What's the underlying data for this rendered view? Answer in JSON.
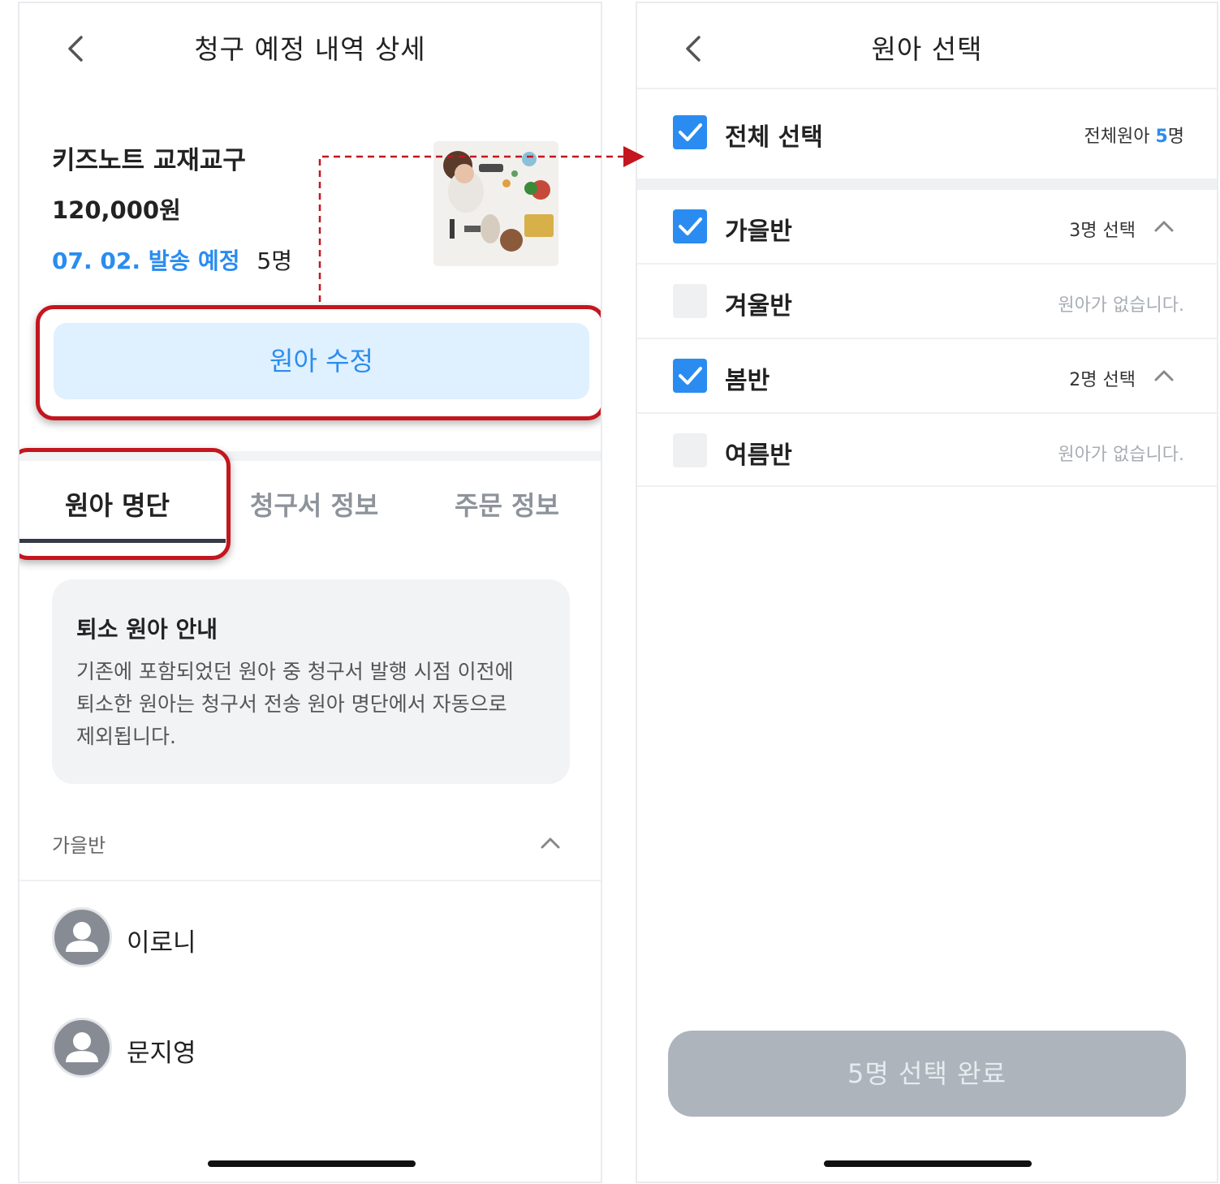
{
  "left": {
    "title": "청구 예정 내역 상세",
    "product": {
      "name": "키즈노트 교재교구",
      "price": "120,000원",
      "ship_date": "07. 02. 발송 예정",
      "count": "5명"
    },
    "edit_button": "원아 수정",
    "tabs": [
      "원아 명단",
      "청구서 정보",
      "주문 정보"
    ],
    "notice": {
      "title": "퇴소 원아 안내",
      "body": "기존에 포함되었던 원아 중 청구서 발행 시점 이전에 퇴소한 원아는 청구서 전송 원아 명단에서 자동으로 제외됩니다."
    },
    "class_name": "가을반",
    "children": [
      "이로니",
      "문지영"
    ]
  },
  "right": {
    "title": "원아 선택",
    "select_all": {
      "label": "전체 선택",
      "count_prefix": "전체원아 ",
      "count_value": "5",
      "count_suffix": "명",
      "checked": true
    },
    "classes": [
      {
        "label": "가을반",
        "status": "3명 선택",
        "checked": true
      },
      {
        "label": "겨울반",
        "status": "원아가 없습니다.",
        "checked": false
      },
      {
        "label": "봄반",
        "status": "2명 선택",
        "checked": true
      },
      {
        "label": "여름반",
        "status": "원아가 없습니다.",
        "checked": false
      }
    ],
    "done_button": "5명 선택 완료"
  },
  "colors": {
    "accent": "#2a8cf0",
    "highlight": "#c3161e",
    "edit_button_bg": "#dff0ff",
    "disabled_button_bg": "#adb4bc"
  },
  "icons": [
    "back-chevron-icon",
    "chevron-up-icon",
    "checkmark-icon",
    "person-avatar-icon"
  ]
}
